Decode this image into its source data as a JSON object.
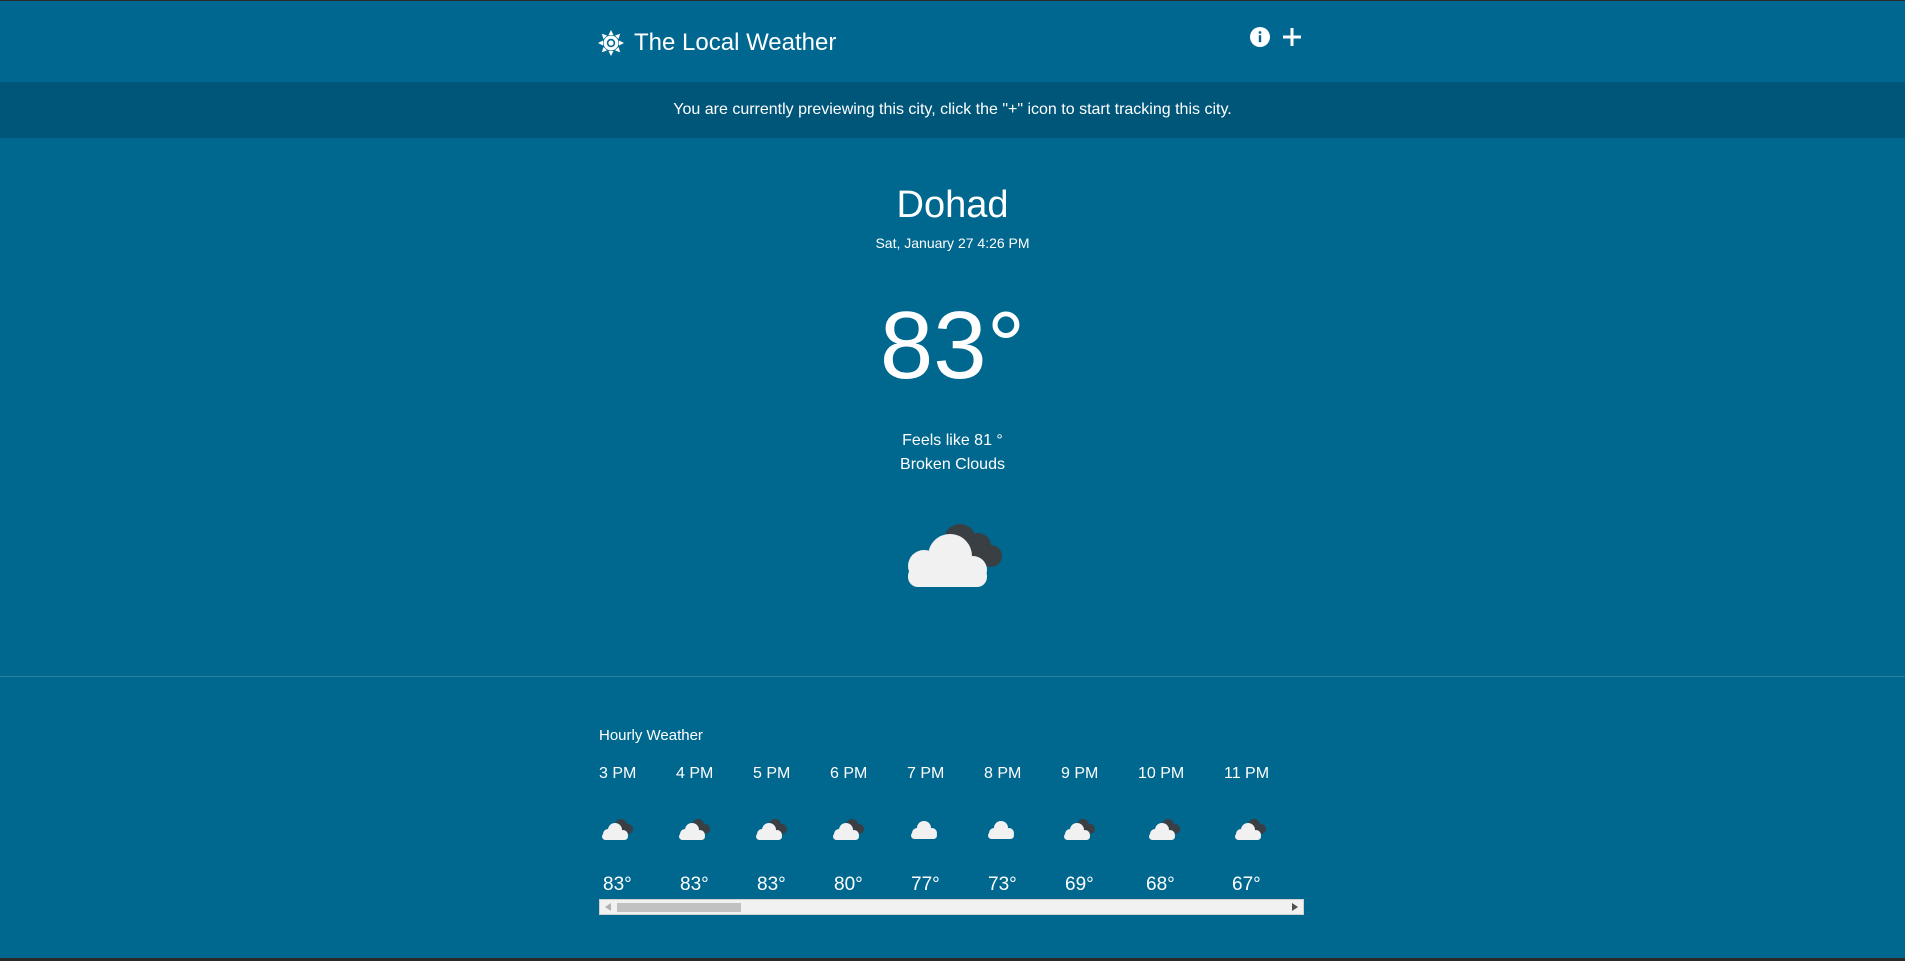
{
  "app": {
    "title": "The Local Weather"
  },
  "banner": {
    "text": "You are currently previewing this city, click the \"+\" icon to start tracking this city."
  },
  "current": {
    "city": "Dohad",
    "datetime": "Sat, January 27 4:26 PM",
    "temperature": "83°",
    "feels_like": "Feels like 81 °",
    "condition": "Broken Clouds",
    "icon": "broken-clouds-icon"
  },
  "hourly": {
    "title": "Hourly Weather",
    "hours": [
      {
        "time": "3 PM",
        "temp": "83°",
        "icon": "broken-clouds-icon"
      },
      {
        "time": "4 PM",
        "temp": "83°",
        "icon": "broken-clouds-icon"
      },
      {
        "time": "5 PM",
        "temp": "83°",
        "icon": "broken-clouds-icon"
      },
      {
        "time": "6 PM",
        "temp": "80°",
        "icon": "broken-clouds-icon"
      },
      {
        "time": "7 PM",
        "temp": "77°",
        "icon": "cloud-icon"
      },
      {
        "time": "8 PM",
        "temp": "73°",
        "icon": "cloud-icon"
      },
      {
        "time": "9 PM",
        "temp": "69°",
        "icon": "broken-clouds-icon"
      },
      {
        "time": "10 PM",
        "temp": "68°",
        "icon": "broken-clouds-icon"
      },
      {
        "time": "11 PM",
        "temp": "67°",
        "icon": "broken-clouds-icon"
      }
    ]
  },
  "colors": {
    "header": "#006790",
    "banner": "#005679",
    "main": "#00678f"
  }
}
